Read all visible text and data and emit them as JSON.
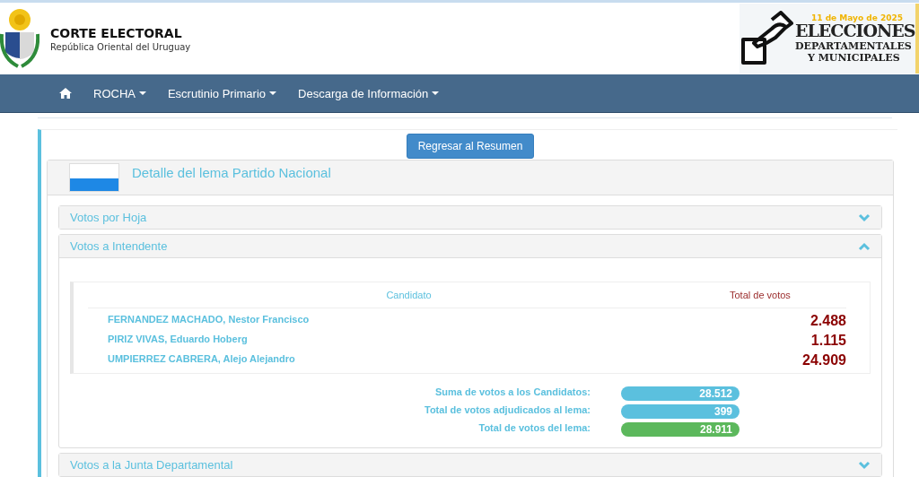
{
  "header": {
    "title": "CORTE ELECTORAL",
    "subtitle": "República Oriental del Uruguay",
    "banner": {
      "date": "11 de Mayo de 2025",
      "line_1": "ELECCIONES",
      "line_2": "DEPARTAMENTALES",
      "line_3": "Y MUNICIPALES"
    }
  },
  "nav": {
    "items": [
      {
        "label": "ROCHA",
        "dropdown": true
      },
      {
        "label": "Escrutinio Primario",
        "dropdown": true
      },
      {
        "label": "Descarga de Información",
        "dropdown": true
      }
    ]
  },
  "back_button": "Regresar al Resumen",
  "lema_panel": {
    "title": "Detalle del lema Partido Nacional",
    "sections": [
      {
        "title": "Votos por Hoja",
        "expanded": false
      },
      {
        "title": "Votos a Intendente",
        "expanded": true
      },
      {
        "title": "Votos a la Junta Departamental",
        "expanded": false
      }
    ],
    "table": {
      "columns": [
        "Candidato",
        "Total de votos"
      ],
      "rows": [
        {
          "candidate": "FERNANDEZ MACHADO, Nestor Francisco",
          "votes": "2.488"
        },
        {
          "candidate": "PIRIZ VIVAS, Eduardo Hoberg",
          "votes": "1.115"
        },
        {
          "candidate": "UMPIERREZ CABRERA, Alejo Alejandro",
          "votes": "24.909"
        }
      ]
    },
    "summary": [
      {
        "label": "Suma de votos a los Candidatos:",
        "value": "28.512",
        "color": "#5bc0de"
      },
      {
        "label": "Total de votos adjudicados al lema:",
        "value": "399",
        "color": "#5bc0de"
      },
      {
        "label": "Total de votos del lema:",
        "value": "28.911",
        "color": "#5cb85c"
      }
    ]
  }
}
